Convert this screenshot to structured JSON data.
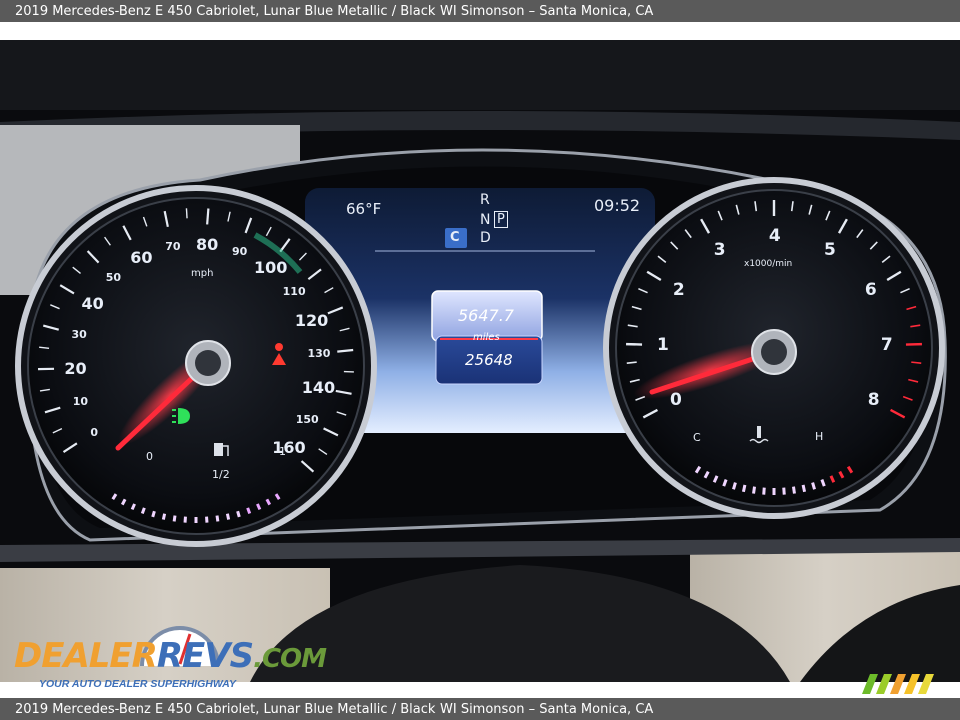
{
  "caption": {
    "vehicle": "2019 Mercedes-Benz E 450 Cabriolet,  Lunar Blue Metallic / Black",
    "dealer": "WI Simonson – Santa Monica, CA"
  },
  "cluster": {
    "temperature": "66°F",
    "clock": "09:52",
    "gear_r": "R",
    "gear_n": "N",
    "gear_p": "P",
    "gear_d": "D",
    "drive_mode": "C",
    "trip_value": "5647.7",
    "trip_unit": "miles",
    "odometer": "25648"
  },
  "speedometer": {
    "unit": "mph",
    "labels": [
      "0",
      "10",
      "20",
      "30",
      "40",
      "50",
      "60",
      "70",
      "80",
      "90",
      "100",
      "110",
      "120",
      "130",
      "140",
      "150",
      "160"
    ],
    "fuel_empty": "0",
    "fuel_half": "1/2",
    "fuel_full": "1"
  },
  "tachometer": {
    "unit": "x1000/min",
    "labels": [
      "0",
      "1",
      "2",
      "3",
      "4",
      "5",
      "6",
      "7",
      "8"
    ],
    "coolant_cold": "C",
    "coolant_hot": "H"
  },
  "watermark": {
    "logo_part1": "DEALER",
    "logo_part2": "REVS",
    "logo_part3": ".COM",
    "tagline": "YOUR AUTO DEALER SUPERHIGHWAY"
  },
  "colors": {
    "needle": "#ff2a3a",
    "accent_blue": "#3d6fb8",
    "accent_orange": "#f0a030",
    "caption_bar": "#5a5a5a"
  }
}
